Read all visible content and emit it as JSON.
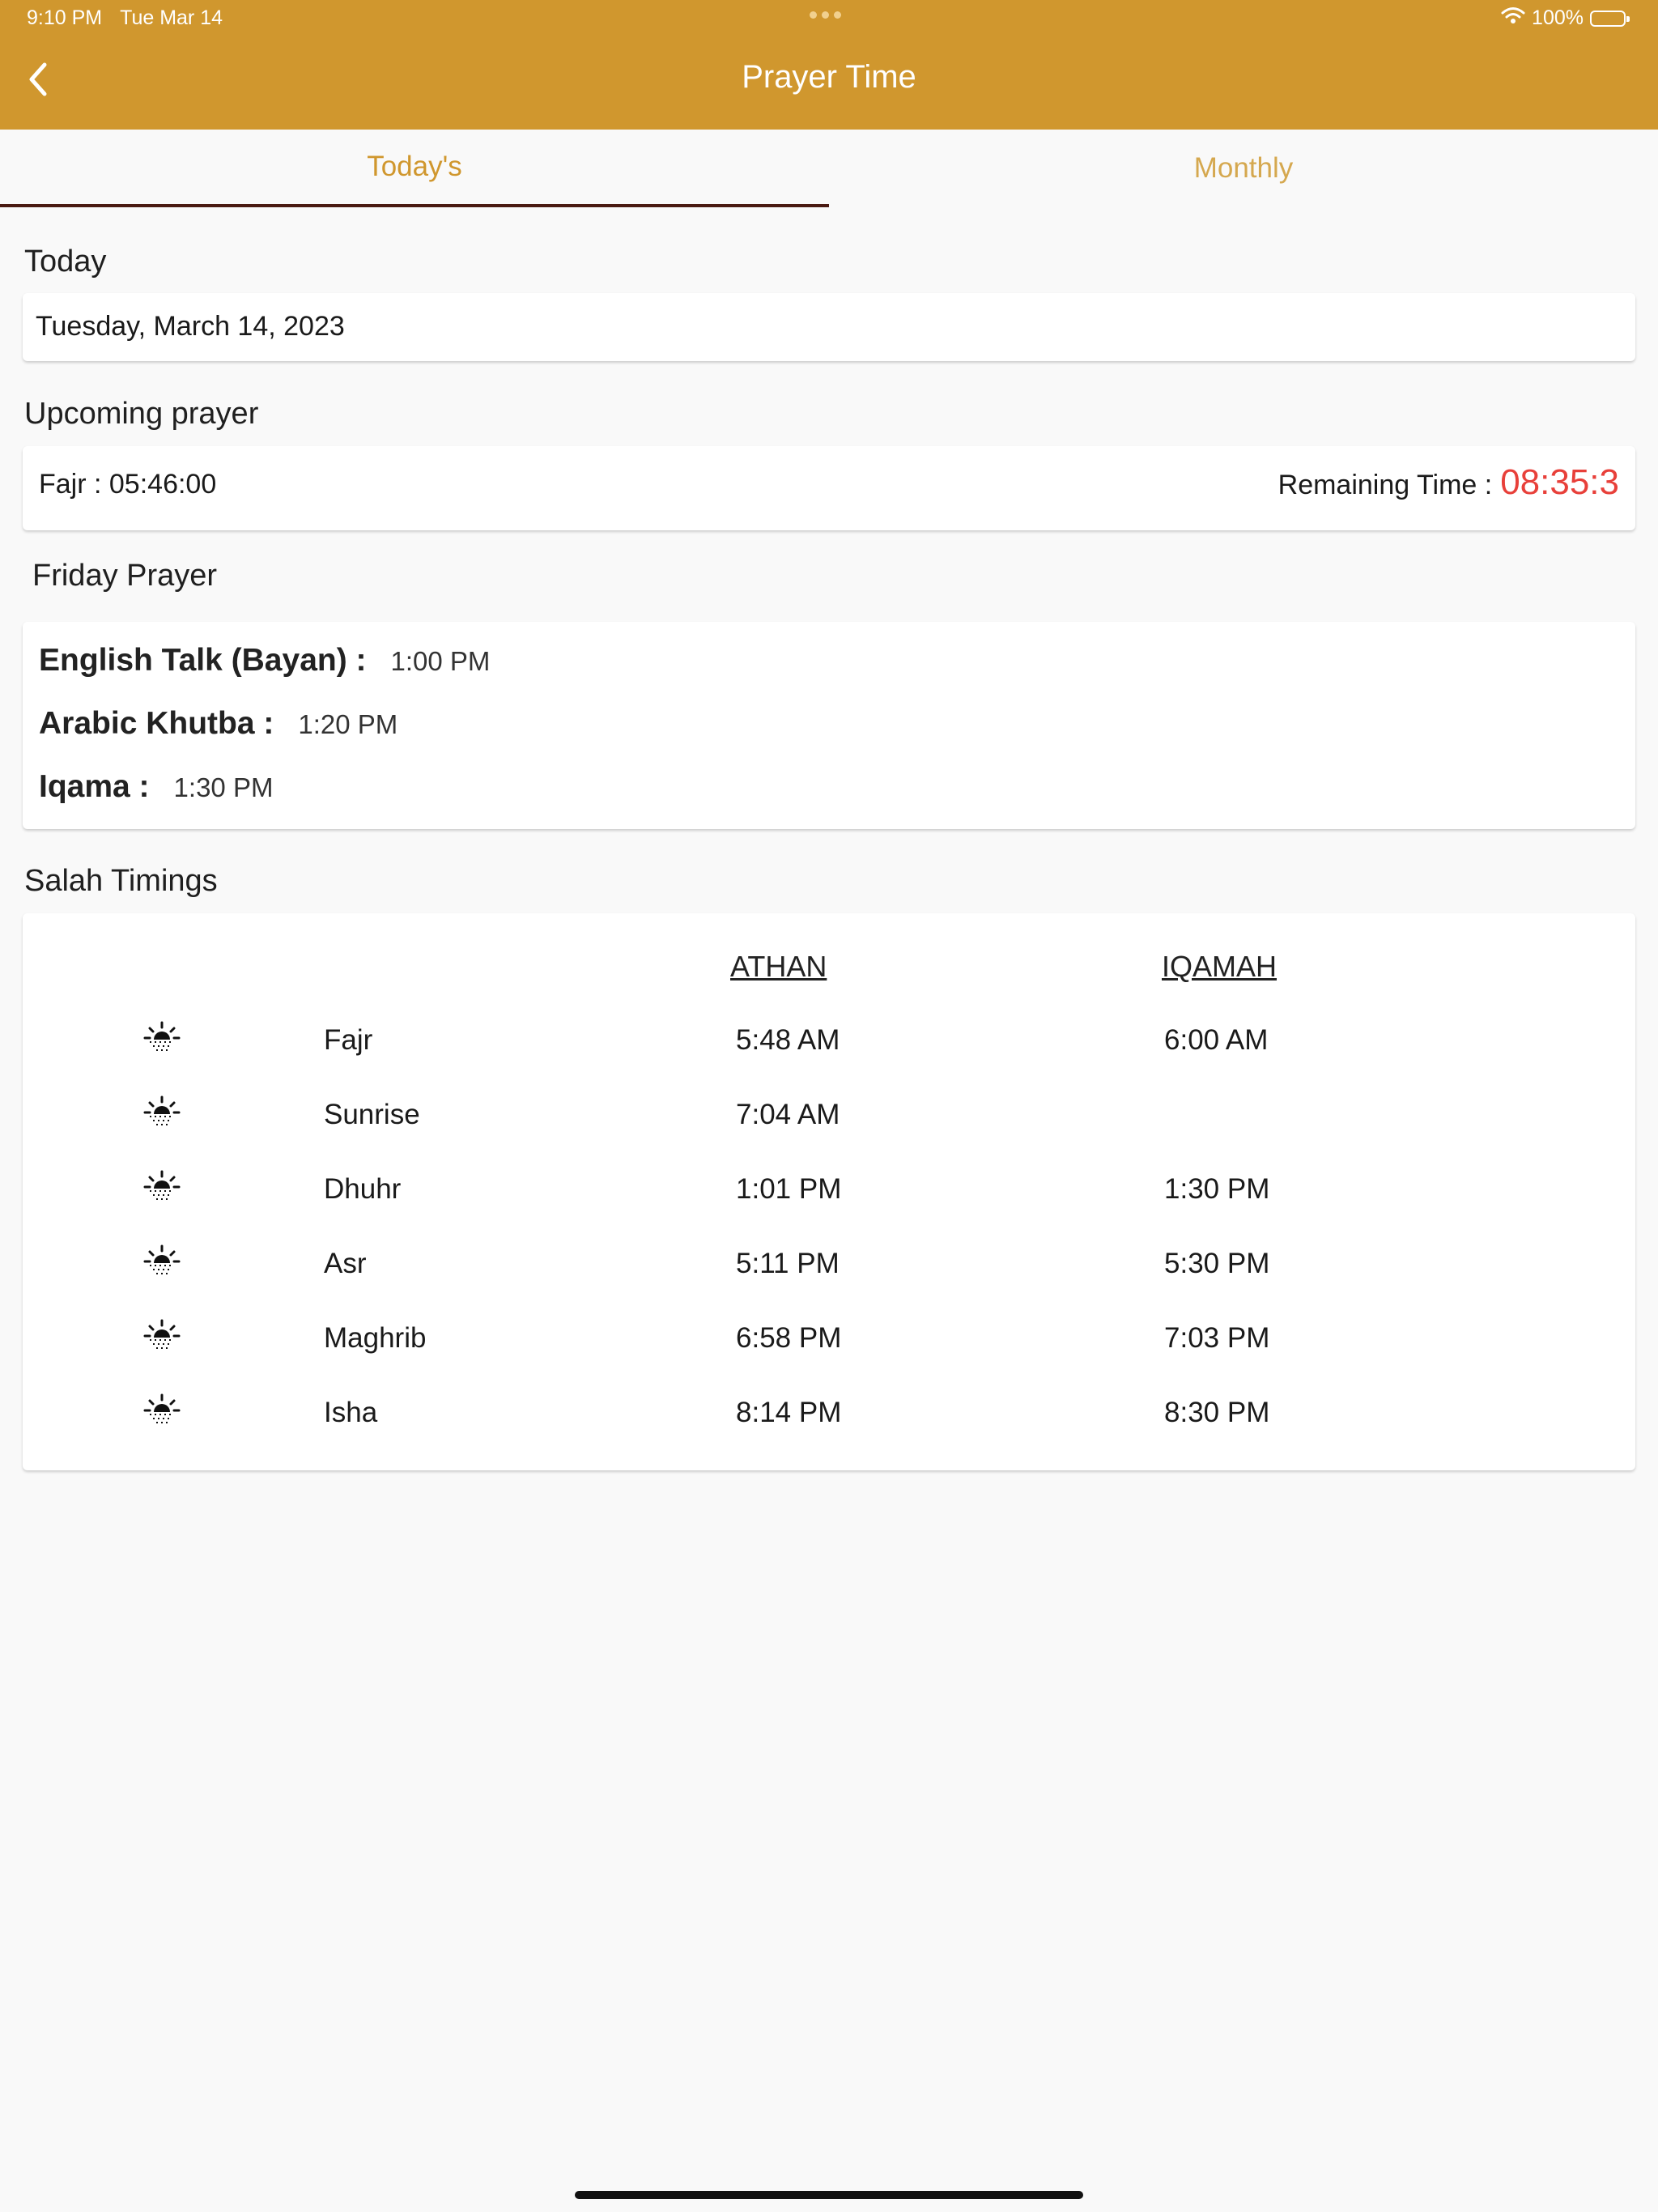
{
  "status_bar": {
    "time": "9:10 PM",
    "date": "Tue Mar 14",
    "battery": "100%"
  },
  "header": {
    "title": "Prayer Time"
  },
  "tabs": [
    {
      "label": "Today's"
    },
    {
      "label": "Monthly"
    }
  ],
  "today": {
    "label": "Today",
    "date": "Tuesday, March 14, 2023"
  },
  "upcoming": {
    "label": "Upcoming prayer",
    "prayer": "Fajr : 05:46:00",
    "remaining_label": "Remaining Time :",
    "remaining_value": "08:35:3"
  },
  "friday": {
    "label": "Friday Prayer",
    "items": [
      {
        "key": "English Talk (Bayan) :",
        "value": "1:00 PM"
      },
      {
        "key": "Arabic Khutba :",
        "value": "1:20 PM"
      },
      {
        "key": "Iqama :",
        "value": "1:30 PM"
      }
    ]
  },
  "salah": {
    "label": "Salah Timings",
    "columns": {
      "athan": "ATHAN",
      "iqamah": "IQAMAH"
    },
    "rows": [
      {
        "name": "Fajr",
        "athan": "5:48 AM",
        "iqamah": "6:00 AM"
      },
      {
        "name": "Sunrise",
        "athan": "7:04 AM",
        "iqamah": ""
      },
      {
        "name": "Dhuhr",
        "athan": "1:01 PM",
        "iqamah": "1:30 PM"
      },
      {
        "name": "Asr",
        "athan": "5:11 PM",
        "iqamah": "5:30 PM"
      },
      {
        "name": "Maghrib",
        "athan": "6:58 PM",
        "iqamah": "7:03 PM"
      },
      {
        "name": "Isha",
        "athan": "8:14 PM",
        "iqamah": "8:30 PM"
      }
    ]
  },
  "colors": {
    "header_bg": "#d0972e",
    "accent": "#d0972e",
    "remaining": "#e8403a",
    "tab_indicator": "#4a1a12"
  },
  "icons": {
    "back": "chevron-left-icon",
    "prayer_row": "sunrise-icon",
    "wifi": "wifi-icon",
    "battery": "battery-icon"
  }
}
